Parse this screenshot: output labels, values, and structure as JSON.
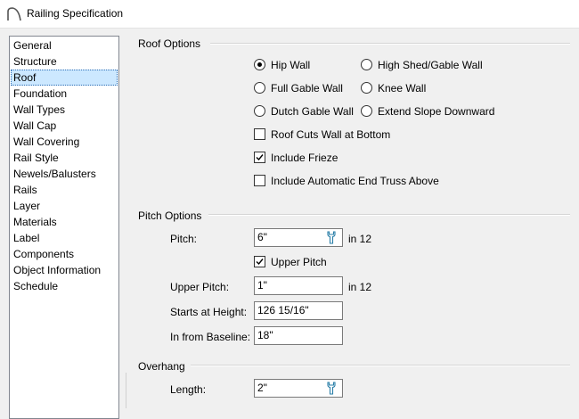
{
  "window": {
    "title": "Railing Specification"
  },
  "nav": {
    "items": [
      "General",
      "Structure",
      "Roof",
      "Foundation",
      "Wall Types",
      "Wall Cap",
      "Wall Covering",
      "Rail Style",
      "Newels/Balusters",
      "Rails",
      "Layer",
      "Materials",
      "Label",
      "Components",
      "Object Information",
      "Schedule"
    ],
    "selected": "Roof"
  },
  "roof_options": {
    "title": "Roof Options",
    "radios": {
      "hip_wall": "Hip Wall",
      "high_shed_gable_wall": "High Shed/Gable Wall",
      "full_gable_wall": "Full Gable Wall",
      "knee_wall": "Knee Wall",
      "dutch_gable_wall": "Dutch Gable Wall",
      "extend_slope_downward": "Extend Slope Downward"
    },
    "selected_radio": "Hip Wall",
    "checks": {
      "roof_cuts_wall": {
        "label": "Roof Cuts Wall at Bottom",
        "checked": false
      },
      "include_frieze": {
        "label": "Include Frieze",
        "checked": true
      },
      "include_end_truss": {
        "label": "Include Automatic End Truss Above",
        "checked": false
      }
    }
  },
  "pitch_options": {
    "title": "Pitch Options",
    "pitch": {
      "label": "Pitch:",
      "value": "6\"",
      "unit": "in 12"
    },
    "upper_pitch_check": {
      "label": "Upper Pitch",
      "checked": true
    },
    "upper_pitch": {
      "label": "Upper Pitch:",
      "value": "1\"",
      "unit": "in 12"
    },
    "starts_at_height": {
      "label": "Starts at Height:",
      "value": "126 15/16\""
    },
    "in_from_baseline": {
      "label": "In from Baseline:",
      "value": "18\""
    }
  },
  "overhang": {
    "title": "Overhang",
    "length": {
      "label": "Length:",
      "value": "2\""
    }
  },
  "icons": {
    "app": "arc-icon",
    "field_tool": "wrench-icon"
  }
}
